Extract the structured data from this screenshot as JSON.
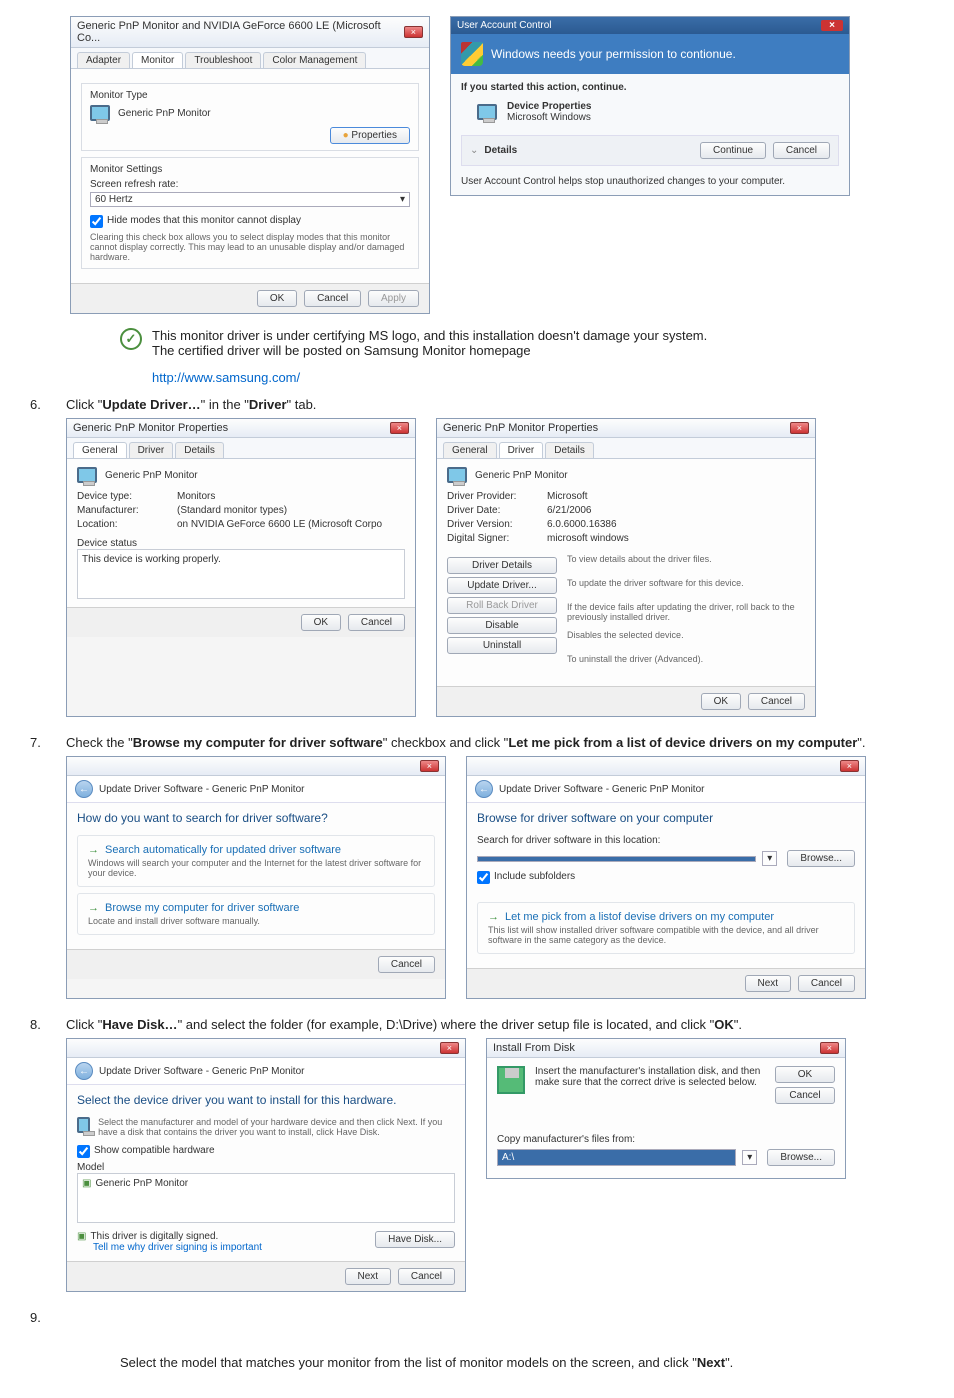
{
  "step5": {
    "monitor_dialog": {
      "title": "Generic PnP Monitor and NVIDIA GeForce 6600 LE (Microsoft Co...",
      "tabs": {
        "adapter": "Adapter",
        "monitor": "Monitor",
        "troubleshoot": "Troubleshoot",
        "color": "Color Management"
      },
      "monitor_type_label": "Monitor Type",
      "monitor_name": "Generic PnP Monitor",
      "properties_btn": "Properties",
      "settings_label": "Monitor Settings",
      "refresh_label": "Screen refresh rate:",
      "refresh_value": "60 Hertz",
      "hide_label": "Hide modes that this monitor cannot display",
      "hide_desc": "Clearing this check box allows you to select display modes that this monitor cannot display correctly. This may lead to an unusable display and/or damaged hardware.",
      "ok": "OK",
      "cancel": "Cancel",
      "apply": "Apply"
    },
    "uac": {
      "title": "User Account Control",
      "banner": "Windows needs your permission to contionue.",
      "started": "If you started this action, continue.",
      "dev_props": "Device Properties",
      "ms_windows": "Microsoft Windows",
      "details": "Details",
      "continue": "Continue",
      "cancel": "Cancel",
      "helps": "User Account Control helps stop unauthorized changes to your computer."
    },
    "note1": "This monitor driver is under certifying MS logo, and this installation doesn't damage your system.",
    "note2": "The certified driver will be posted on Samsung Monitor homepage",
    "url": "http://www.samsung.com/"
  },
  "step6": {
    "num": "6.",
    "text_prefix": "Click \"",
    "update_driver": "Update Driver…",
    "text_mid": "\" in the \"",
    "driver_tab": "Driver",
    "text_suffix": "\" tab.",
    "general_dialog": {
      "title": "Generic PnP Monitor Properties",
      "tabs": {
        "general": "General",
        "driver": "Driver",
        "details": "Details"
      },
      "name": "Generic PnP Monitor",
      "devtype_lbl": "Device type:",
      "devtype_val": "Monitors",
      "manuf_lbl": "Manufacturer:",
      "manuf_val": "(Standard monitor types)",
      "loc_lbl": "Location:",
      "loc_val": "on NVIDIA GeForce 6600 LE (Microsoft Corpo",
      "status_lbl": "Device status",
      "status_val": "This device is working properly.",
      "ok": "OK",
      "cancel": "Cancel"
    },
    "driver_dialog": {
      "title": "Generic PnP Monitor Properties",
      "tabs": {
        "general": "General",
        "driver": "Driver",
        "details": "Details"
      },
      "name": "Generic PnP Monitor",
      "provider_lbl": "Driver Provider:",
      "provider_val": "Microsoft",
      "date_lbl": "Driver Date:",
      "date_val": "6/21/2006",
      "version_lbl": "Driver Version:",
      "version_val": "6.0.6000.16386",
      "signer_lbl": "Digital Signer:",
      "signer_val": "microsoft windows",
      "details_btn": "Driver Details",
      "details_desc": "To view details about the driver files.",
      "update_btn": "Update Driver...",
      "update_desc": "To update the driver software for this device.",
      "rollback_btn": "Roll Back Driver",
      "rollback_desc": "If the device fails after updating the driver, roll back to the previously installed driver.",
      "disable_btn": "Disable",
      "disable_desc": "Disables the selected device.",
      "uninstall_btn": "Uninstall",
      "uninstall_desc": "To uninstall the driver (Advanced).",
      "ok": "OK",
      "cancel": "Cancel"
    }
  },
  "step7": {
    "num": "7.",
    "text_pre": "Check the \"",
    "browse_bold": "Browse my computer for driver software",
    "text_mid": "\" checkbox and click \"",
    "letme_bold": "Let me pick from a list of device drivers on my computer",
    "text_suf": "\".",
    "wiz1": {
      "crumb": "Update Driver Software - Generic PnP Monitor",
      "heading": "How do you want to search for driver software?",
      "opt1_title": "Search automatically for updated driver software",
      "opt1_desc": "Windows will search your computer and the Internet for the latest driver software for your device.",
      "opt2_title": "Browse my computer for driver software",
      "opt2_desc": "Locate and install driver software manually.",
      "cancel": "Cancel"
    },
    "wiz2": {
      "crumb": "Update Driver Software - Generic PnP Monitor",
      "heading": "Browse for driver software on your computer",
      "search_lbl": "Search for driver software in this location:",
      "path": "",
      "browse": "Browse...",
      "include": "Include subfolders",
      "letme_title": "Let me pick from a listof devise drivers on my computer",
      "letme_desc": "This list will show installed driver software compatible with the device, and all driver software in the same category as the device.",
      "next": "Next",
      "cancel": "Cancel"
    }
  },
  "step8": {
    "num": "8.",
    "text_pre": "Click \"",
    "have_disk": "Have Disk…",
    "text_mid": "\" and select the folder (for example, D:\\Drive) where the driver setup file is located, and click \"",
    "ok_bold": "OK",
    "text_suf": "\".",
    "wiz3": {
      "crumb": "Update Driver Software - Generic PnP Monitor",
      "heading": "Select the device driver you want to install for this hardware.",
      "instr": "Select the manufacturer and model of your hardware device and then click Next. If you have a disk that contains the driver you want to install, click Have Disk.",
      "showcompat": "Show compatible hardware",
      "model_lbl": "Model",
      "model_val": "Generic PnP Monitor",
      "signed": "This driver is digitally signed.",
      "tellme": "Tell me why driver signing is important",
      "have_disk_btn": "Have Disk...",
      "next": "Next",
      "cancel": "Cancel"
    },
    "install_disk": {
      "title": "Install From Disk",
      "instr": "Insert the manufacturer's installation disk, and then make sure that the correct drive is selected below.",
      "ok": "OK",
      "cancel": "Cancel",
      "copy_lbl": "Copy manufacturer's files from:",
      "path": "A:\\",
      "browse": "Browse..."
    }
  },
  "step9": {
    "num": "9.",
    "text_pre": "Select the model that matches your monitor from the list of monitor models on the screen, and click \"",
    "next_bold": "Next",
    "text_suf": "\"."
  }
}
